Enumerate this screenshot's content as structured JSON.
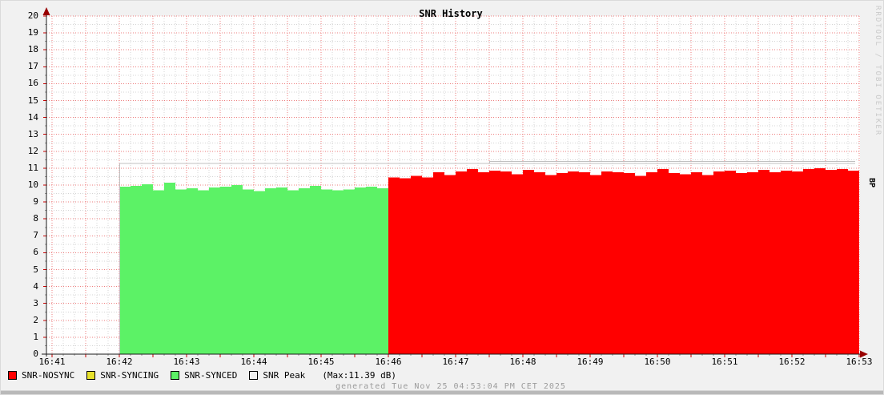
{
  "watermark": {
    "text": "RRDTOOL / TOBI OETIKER"
  },
  "footer": {
    "text": "generated Tue Nov 25 04:53:04 PM CET 2025"
  },
  "legend": {
    "items": [
      {
        "label": "SNR-NOSYNC",
        "color": "#ff0000"
      },
      {
        "label": "SNR-SYNCING",
        "color": "#e8e22d"
      },
      {
        "label": "SNR-SYNCED",
        "color": "#5cf266"
      },
      {
        "label": "SNR Peak",
        "color": "#f0f0f0"
      }
    ],
    "max_note": "(Max:11.39 dB)"
  },
  "chart_data": {
    "type": "area",
    "title": "SNR History",
    "right_axis_label": "BP",
    "ylim": [
      0,
      20
    ],
    "y_tick_step": 1,
    "x_ticks": [
      "16:41",
      "16:42",
      "16:43",
      "16:44",
      "16:45",
      "16:46",
      "16:47",
      "16:48",
      "16:49",
      "16:50",
      "16:51",
      "16:52",
      "16:53"
    ],
    "grid": {
      "major_color": "#ee7d7d",
      "minor_color": "#d4d4d4",
      "major_x_seconds": 30,
      "minor_x_seconds": 10
    },
    "axis_color": "#1a1a1a",
    "arrow_color": "#990000",
    "series": [
      {
        "name": "SNR-SYNCED",
        "color": "#5cf266",
        "start": "16:42",
        "start_min": 1,
        "step_seconds": 10,
        "values": [
          9.9,
          9.95,
          10.05,
          9.7,
          10.15,
          9.75,
          9.8,
          9.7,
          9.85,
          9.9,
          10.0,
          9.75,
          9.65,
          9.8,
          9.85,
          9.7,
          9.8,
          9.95,
          9.75,
          9.7,
          9.75,
          9.85,
          9.9,
          9.8
        ]
      },
      {
        "name": "SNR-NOSYNC",
        "color": "#ff0000",
        "start": "16:46",
        "start_min": 5,
        "step_seconds": 10,
        "values": [
          10.45,
          10.4,
          10.55,
          10.45,
          10.75,
          10.6,
          10.8,
          10.95,
          10.75,
          10.85,
          10.8,
          10.65,
          10.9,
          10.75,
          10.6,
          10.7,
          10.8,
          10.75,
          10.6,
          10.8,
          10.75,
          10.7,
          10.55,
          10.75,
          10.95,
          10.7,
          10.65,
          10.75,
          10.6,
          10.8,
          10.85,
          10.7,
          10.75,
          10.9,
          10.75,
          10.85,
          10.8,
          10.95,
          11.0,
          10.9,
          10.95,
          10.85
        ]
      }
    ],
    "peak": {
      "name": "SNR Peak",
      "color": "#c0c0c0",
      "max": 11.39,
      "lines": [
        {
          "start_min": 1.0,
          "end_min": 11.94,
          "value": 11.28,
          "rise_from_zero": true
        },
        {
          "start_min": 6.5,
          "end_min": 11.94,
          "value": 11.39,
          "rise_from": 11.28
        }
      ]
    }
  }
}
